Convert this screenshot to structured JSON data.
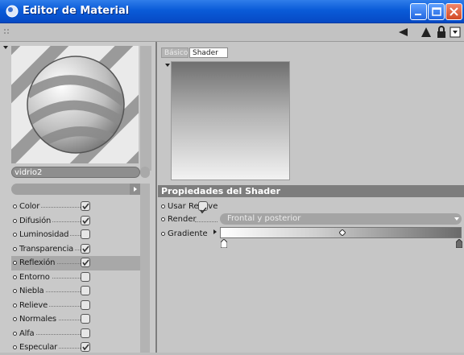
{
  "window": {
    "title": "Editor de Material"
  },
  "left": {
    "material_name": "vidrio2",
    "channels": [
      {
        "label": "Color",
        "checked": true
      },
      {
        "label": "Difusión",
        "checked": true
      },
      {
        "label": "Luminosidad",
        "checked": false
      },
      {
        "label": "Transparencia",
        "checked": true
      },
      {
        "label": "Reflexión",
        "checked": true,
        "selected": true
      },
      {
        "label": "Entorno",
        "checked": false
      },
      {
        "label": "Niebla",
        "checked": false
      },
      {
        "label": "Relieve",
        "checked": false
      },
      {
        "label": "Normales",
        "checked": false
      },
      {
        "label": "Alfa",
        "checked": false
      },
      {
        "label": "Especular",
        "checked": true
      }
    ]
  },
  "right": {
    "tabs": [
      {
        "label": "Básico",
        "active": false
      },
      {
        "label": "Shader",
        "active": true
      }
    ],
    "section_title": "Propiedades del Shader",
    "props": {
      "use_bump_label": "Usar Relieve",
      "use_bump_checked": true,
      "render_label": "Render",
      "render_value": "Frontal y posterior",
      "gradient_label": "Gradiente"
    }
  },
  "icons": {
    "window_icon": "material-icon",
    "minimize": "minimize-icon",
    "maximize": "maximize-icon",
    "close": "close-icon",
    "back": "back-arrow-icon",
    "up": "up-arrow-icon",
    "lock": "lock-icon",
    "menu": "panel-menu-icon"
  },
  "colors": {
    "titlebar": "#0a5bd8",
    "section_header": "#7d7d7d"
  }
}
